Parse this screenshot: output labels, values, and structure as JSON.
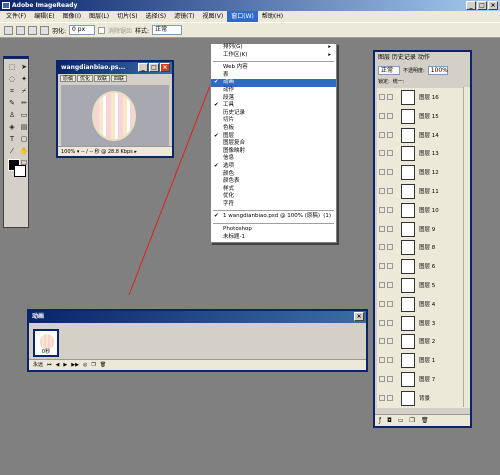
{
  "app": {
    "title": "Adobe ImageReady"
  },
  "menubar": [
    "文件(F)",
    "编辑(E)",
    "图像(I)",
    "图层(L)",
    "切片(S)",
    "选择(S)",
    "滤镜(T)",
    "视图(V)",
    "窗口(W)",
    "帮助(H)"
  ],
  "options": {
    "feather_label": "羽化:",
    "feather_value": "0 px",
    "antialias_label": "消除锯齿",
    "style_label": "样式:",
    "style_value": "正常"
  },
  "doc": {
    "title": "wangdianbiao.ps...",
    "tabs": [
      "原稿",
      "优化",
      "双联",
      "四联"
    ],
    "status": "100% ▾  -- / -- 秒 @ 28.8 Kbps ▸"
  },
  "dropdown": [
    {
      "label": "排列(G)",
      "arrow": "▸"
    },
    {
      "label": "工作区(K)",
      "arrow": "▸"
    },
    {
      "sep": true
    },
    {
      "label": "Web 内容"
    },
    {
      "label": "表"
    },
    {
      "label": "动画",
      "check": "✔",
      "hi": true
    },
    {
      "label": "动作"
    },
    {
      "label": "段落"
    },
    {
      "label": "工具",
      "check": "✔"
    },
    {
      "label": "历史记录"
    },
    {
      "label": "切片"
    },
    {
      "label": "色板"
    },
    {
      "label": "图层",
      "check": "✔"
    },
    {
      "label": "图层复合"
    },
    {
      "label": "图像映射"
    },
    {
      "label": "信息"
    },
    {
      "label": "选项",
      "check": "✔"
    },
    {
      "label": "颜色"
    },
    {
      "label": "颜色表"
    },
    {
      "label": "样式"
    },
    {
      "label": "优化"
    },
    {
      "label": "字符"
    },
    {
      "sep": true
    },
    {
      "label": "1 wangdianbiao.psd @ 100% (原稿)",
      "check": "✔",
      "arrow": "(1)"
    },
    {
      "sep": true
    },
    {
      "label": "Photoshop"
    },
    {
      "label": "  未标题-1"
    }
  ],
  "anim": {
    "title": "动画",
    "frame_label": "0秒",
    "loop": "永远"
  },
  "layers": {
    "tabs": "图层 历史记录 动作",
    "blend": "正常",
    "opacity_label": "不透明度:",
    "opacity": "100%",
    "lock_label": "锁定:",
    "fill_label": "统一:",
    "rows": [
      "图层 16",
      "图层 15",
      "图层 14",
      "图层 13",
      "图层 12",
      "图层 11",
      "图层 10",
      "图层 9",
      "图层 8",
      "图层 6",
      "图层 5",
      "图层 4",
      "图层 3",
      "图层 2",
      "图层 1",
      "图层 7",
      "背景"
    ]
  }
}
